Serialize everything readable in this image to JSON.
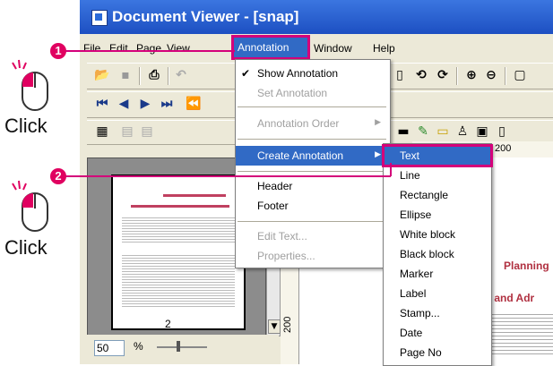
{
  "callouts": {
    "step1": "1",
    "step2": "2",
    "click_label": "Click"
  },
  "window": {
    "title": "Document Viewer - [snap]"
  },
  "menubar": {
    "items": [
      "File",
      "Edit",
      "Page",
      "View",
      "Annotation",
      "Window",
      "Help"
    ],
    "active": "Annotation"
  },
  "annotation_menu": {
    "items": [
      {
        "label": "Show Annotation",
        "checked": true,
        "enabled": true
      },
      {
        "label": "Set Annotation",
        "enabled": false
      },
      {
        "label": "Annotation Order",
        "enabled": false,
        "submenu": true
      },
      {
        "label": "Create Annotation",
        "enabled": true,
        "submenu": true,
        "highlighted": true
      },
      {
        "label": "Header",
        "enabled": true
      },
      {
        "label": "Footer",
        "enabled": true
      },
      {
        "label": "Edit Text...",
        "enabled": false
      },
      {
        "label": "Properties...",
        "enabled": false
      }
    ]
  },
  "create_annotation_submenu": {
    "items": [
      "Text",
      "Line",
      "Rectangle",
      "Ellipse",
      "White block",
      "Black block",
      "Marker",
      "Label",
      "Stamp...",
      "Date",
      "Page No"
    ],
    "selected": "Text"
  },
  "left_pane": {
    "zoom_value": "50",
    "zoom_unit": "%",
    "page_number": "2"
  },
  "document": {
    "heading_fragment": "Planning",
    "subheading_fragment": "ent and Adr",
    "ruler_h_label": "200",
    "ruler_v_label": "200"
  },
  "colors": {
    "highlight": "#d4007a",
    "selection": "#316ac5",
    "title_bar": "#1d4fc2"
  }
}
